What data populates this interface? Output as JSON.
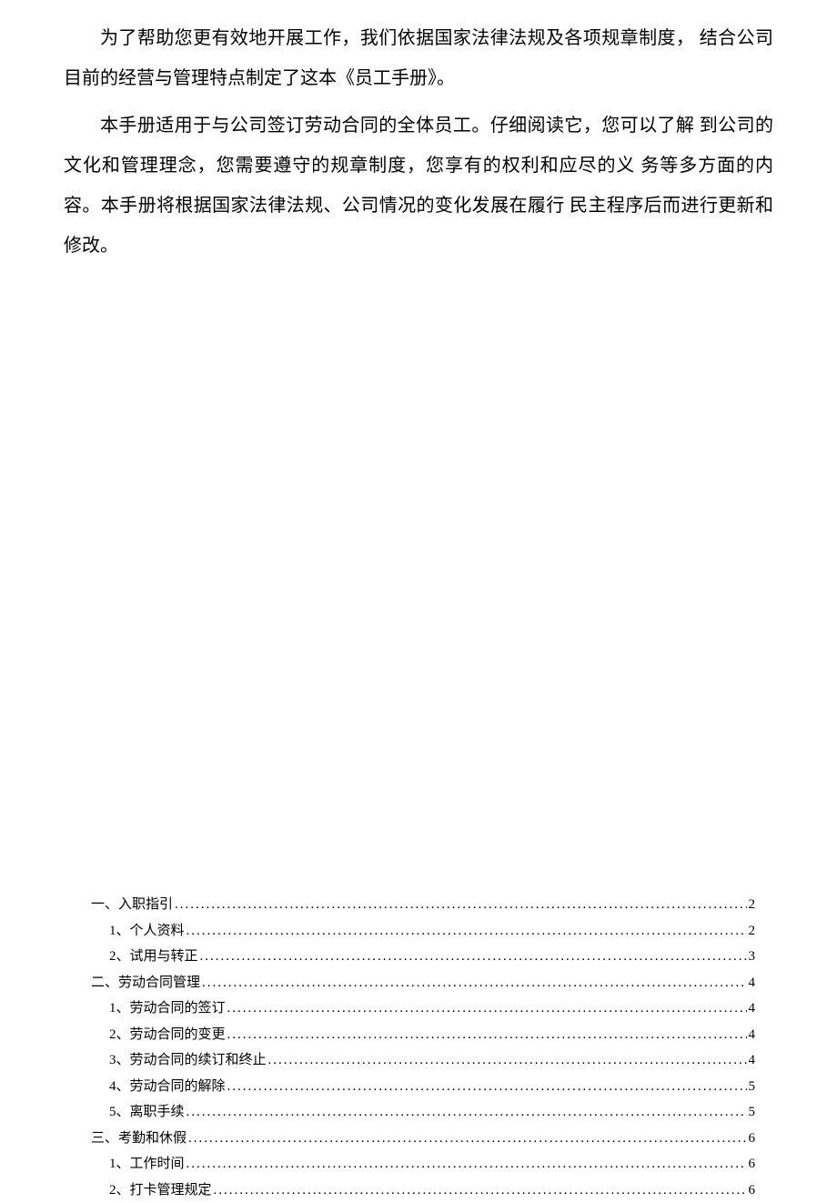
{
  "paragraphs": {
    "p1": "为了帮助您更有效地开展工作，我们依据国家法律法规及各项规章制度， 结合公司目前的经营与管理特点制定了这本《员工手册》。",
    "p2": "本手册适用于与公司签订劳动合同的全体员工。仔细阅读它，您可以了解 到公司的文化和管理理念，您需要遵守的规章制度，您享有的权利和应尽的义 务等多方面的内容。本手册将根据国家法律法规、公司情况的变化发展在履行 民主程序后而进行更新和修改。"
  },
  "toc": {
    "items": [
      {
        "label": "一、入职指引",
        "page": "2",
        "level": 1
      },
      {
        "label": "1、个人资料",
        "page": "2",
        "level": 2
      },
      {
        "label": "2、试用与转正",
        "page": "3",
        "level": 2
      },
      {
        "label": "二、劳动合同管理",
        "page": "4",
        "level": 1
      },
      {
        "label": "1、劳动合同的签订",
        "page": "4",
        "level": 2
      },
      {
        "label": "2、劳动合同的变更",
        "page": "4",
        "level": 2
      },
      {
        "label": "3、劳动合同的续订和终止",
        "page": "4",
        "level": 2
      },
      {
        "label": "4、劳动合同的解除",
        "page": "5",
        "level": 2
      },
      {
        "label": "5、离职手续",
        "page": "5",
        "level": 2
      },
      {
        "label": "三、考勤和休假",
        "page": "6",
        "level": 1
      },
      {
        "label": "1、工作时间",
        "page": "6",
        "level": 2
      },
      {
        "label": "2、打卡管理规定",
        "page": "6",
        "level": 2
      }
    ]
  }
}
